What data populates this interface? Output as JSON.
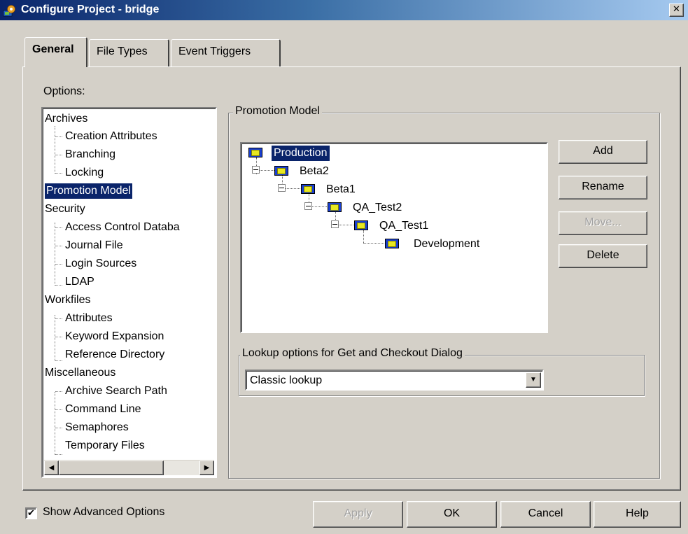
{
  "window": {
    "title": "Configure Project - bridge",
    "close_glyph": "✕"
  },
  "tabs": [
    {
      "label": "General",
      "active": true
    },
    {
      "label": "File Types",
      "active": false
    },
    {
      "label": "Event Triggers",
      "active": false
    }
  ],
  "options": {
    "label": "Options:",
    "items": [
      {
        "label": "Archives",
        "level": 0
      },
      {
        "label": "Creation Attributes",
        "level": 1
      },
      {
        "label": "Branching",
        "level": 1
      },
      {
        "label": "Locking",
        "level": 1
      },
      {
        "label": "Promotion Model",
        "level": 0,
        "selected": true
      },
      {
        "label": "Security",
        "level": 0
      },
      {
        "label": "Access Control Databa",
        "level": 1
      },
      {
        "label": "Journal File",
        "level": 1
      },
      {
        "label": "Login Sources",
        "level": 1
      },
      {
        "label": "LDAP",
        "level": 1
      },
      {
        "label": "Workfiles",
        "level": 0
      },
      {
        "label": "Attributes",
        "level": 1
      },
      {
        "label": "Keyword Expansion",
        "level": 1
      },
      {
        "label": "Reference Directory",
        "level": 1
      },
      {
        "label": "Miscellaneous",
        "level": 0
      },
      {
        "label": "Archive Search Path",
        "level": 1
      },
      {
        "label": "Command Line",
        "level": 1
      },
      {
        "label": "Semaphores",
        "level": 1
      },
      {
        "label": "Temporary Files",
        "level": 1
      }
    ]
  },
  "promotion_model": {
    "legend": "Promotion Model",
    "nodes": [
      {
        "label": "Production",
        "depth": 0,
        "selected": true
      },
      {
        "label": "Beta2",
        "depth": 1
      },
      {
        "label": "Beta1",
        "depth": 2
      },
      {
        "label": "QA_Test2",
        "depth": 3
      },
      {
        "label": "QA_Test1",
        "depth": 4
      },
      {
        "label": "Development",
        "depth": 5
      }
    ],
    "buttons": {
      "add": "Add",
      "rename": "Rename",
      "move": "Move...",
      "delete": "Delete"
    }
  },
  "lookup": {
    "legend": "Lookup options for Get and Checkout Dialog",
    "selected": "Classic lookup"
  },
  "footer": {
    "show_advanced_label": "Show Advanced Options",
    "show_advanced_checked": true,
    "apply": "Apply",
    "ok": "OK",
    "cancel": "Cancel",
    "help": "Help"
  },
  "icons": {
    "app": "project-config-icon",
    "node": "promotion-level-icon"
  }
}
